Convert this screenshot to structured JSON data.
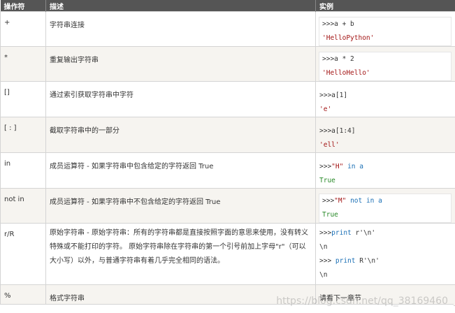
{
  "header": {
    "col1": "操作符",
    "col2": "描述",
    "col3": "实例"
  },
  "rows": [
    {
      "op": "+",
      "desc": "字符串连接",
      "ex1": ">>>a + b",
      "ex2": "'HelloPython'"
    },
    {
      "op": "*",
      "desc": "重复输出字符串",
      "ex1": ">>>a * 2",
      "ex2": "'HelloHello'"
    },
    {
      "op": "[]",
      "desc": "通过索引获取字符串中字符",
      "ex1": ">>>a[1]",
      "ex2": "'e'"
    },
    {
      "op": "[ : ]",
      "desc": "截取字符串中的一部分",
      "ex1": ">>>a[1:4]",
      "ex2": "'ell'"
    },
    {
      "op": "in",
      "desc": "成员运算符 - 如果字符串中包含给定的字符返回 True",
      "ex1_pre": ">>>",
      "ex1_str": "\"H\"",
      "ex1_kw": " in ",
      "ex1_var": "a",
      "ex2": "True"
    },
    {
      "op": "not in",
      "desc": "成员运算符 - 如果字符串中不包含给定的字符返回 True",
      "ex1_pre": ">>>",
      "ex1_str": "\"M\"",
      "ex1_kw": " not in ",
      "ex1_var": "a",
      "ex2": "True"
    },
    {
      "op": "r/R",
      "desc": "原始字符串 - 原始字符串：所有的字符串都是直接按照字面的意思来使用，没有转义特殊或不能打印的字符。 原始字符串除在字符串的第一个引号前加上字母\"r\"（可以大小写）以外，与普通字符串有着几乎完全相同的语法。",
      "ex1_pre": ">>>",
      "ex1_kw": "print",
      "ex1_rest": " r'\\n'",
      "ex2": "\\n",
      "ex3_pre": ">>> ",
      "ex3_kw": "print",
      "ex3_rest": " R'\\n'",
      "ex4": "\\n"
    },
    {
      "op": "%",
      "desc": "格式字符串",
      "ex1": "请看下一章节"
    }
  ],
  "watermark": "https://blog.csdn.net/qq_38169460"
}
